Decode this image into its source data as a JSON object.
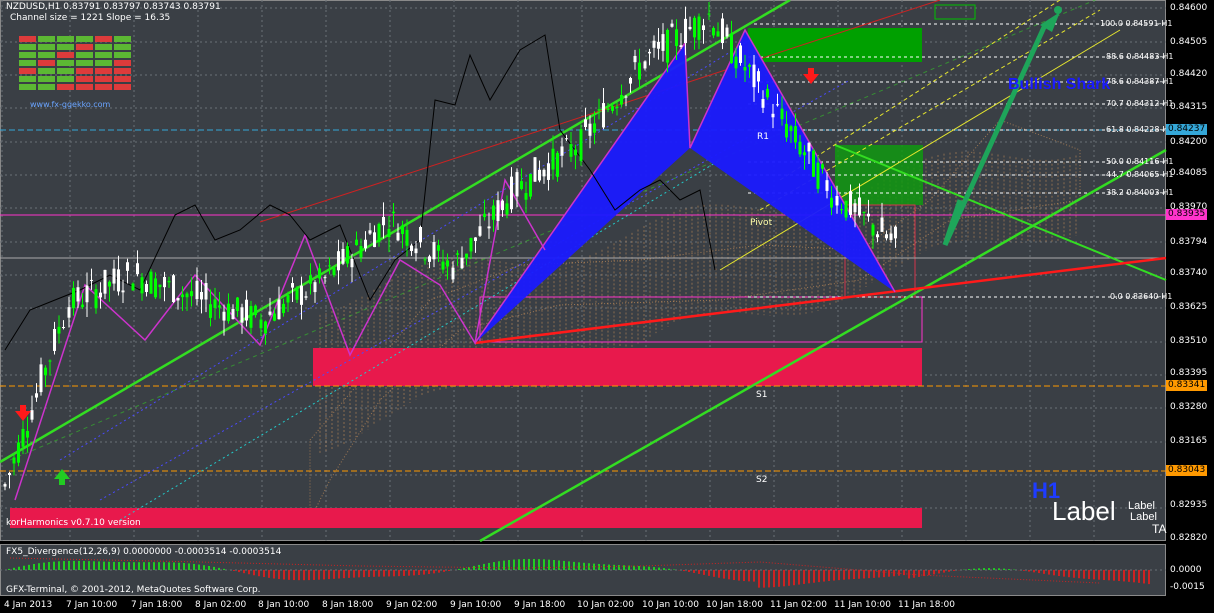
{
  "header": {
    "symbol_line": "NZDUSD,H1  0.83791 0.83797 0.83743 0.83791",
    "channel_line": "Channel size = 1221 Slope = 16.35",
    "logo_url": "www.fx-ggekko.com"
  },
  "indicator_main": "korHarmonics v0.7.10 version",
  "indicator_sub": "FX5_Divergence(12,26,9) 0.0000000 -0.0003514 -0.0003514",
  "copyright": "GFX-Terminal, © 2001-2012, MetaQuotes Software Corp.",
  "pattern_label": "Bullish Shark",
  "pivots": {
    "r1": "R1",
    "pivot": "Pivot",
    "s1": "S1",
    "s2": "S2"
  },
  "fib_levels": [
    {
      "text": "100.0 0.84591-H1"
    },
    {
      "text": "88.6 0.84483-H1"
    },
    {
      "text": "78.6 0.84387-H1"
    },
    {
      "text": "70.7 0.84312-H1"
    },
    {
      "text": "61.8 0.84228-H1"
    },
    {
      "text": "50.0 0.84116-H1"
    },
    {
      "text": "44.7 0.84065-H1"
    },
    {
      "text": "38.2 0.84003-H1"
    },
    {
      "text": "0.0 0.83640-H1"
    }
  ],
  "price_axis": [
    "0.84600",
    "0.84505",
    "0.84420",
    "0.84315",
    "0.84200",
    "0.84085",
    "0.83970",
    "0.83794",
    "0.83740",
    "0.83625",
    "0.83510",
    "0.83395",
    "0.83280",
    "0.83165",
    "0.83050",
    "0.82935",
    "0.82820"
  ],
  "price_tags": {
    "cyan": "0.84237",
    "magenta": "0.83935",
    "orange1": "0.83341",
    "orange2": "0.83043"
  },
  "sub_axis": [
    "0.0000",
    "-0.0015"
  ],
  "time_axis": [
    "4 Jan 2013",
    "7 Jan 10:00",
    "7 Jan 18:00",
    "8 Jan 02:00",
    "8 Jan 10:00",
    "8 Jan 18:00",
    "9 Jan 02:00",
    "9 Jan 10:00",
    "9 Jan 18:00",
    "10 Jan 02:00",
    "10 Jan 10:00",
    "10 Jan 18:00",
    "11 Jan 02:00",
    "11 Jan 10:00",
    "11 Jan 18:00"
  ],
  "corner_labels": {
    "h1": "H1",
    "label_big": "Label",
    "label_small1": "Label",
    "label_small2": "Label",
    "ta": "TA"
  },
  "colors": {
    "background": "#3a3f45",
    "bull": "#ffffff",
    "bear": "#00ff00",
    "channel": "#33dd22",
    "pattern": "#1a1aff",
    "resistance": "#ff1a4d",
    "fib": "#ffffff"
  },
  "chart_data": {
    "type": "line",
    "title": "NZDUSD,H1",
    "ylim": [
      0.8282,
      0.846
    ],
    "x": [
      "4 Jan 2013",
      "7 Jan 10:00",
      "7 Jan 18:00",
      "8 Jan 02:00",
      "8 Jan 10:00",
      "8 Jan 18:00",
      "9 Jan 02:00",
      "9 Jan 10:00",
      "9 Jan 18:00",
      "10 Jan 02:00",
      "10 Jan 10:00",
      "10 Jan 18:00",
      "11 Jan 02:00",
      "11 Jan 10:00",
      "11 Jan 18:00"
    ],
    "series": [
      {
        "name": "NZDUSD,H1",
        "values": [
          0.83,
          0.836,
          0.837,
          0.8362,
          0.8355,
          0.8368,
          0.8388,
          0.8372,
          0.8398,
          0.8413,
          0.844,
          0.8455,
          0.8425,
          0.8395,
          0.8379
        ]
      }
    ]
  }
}
